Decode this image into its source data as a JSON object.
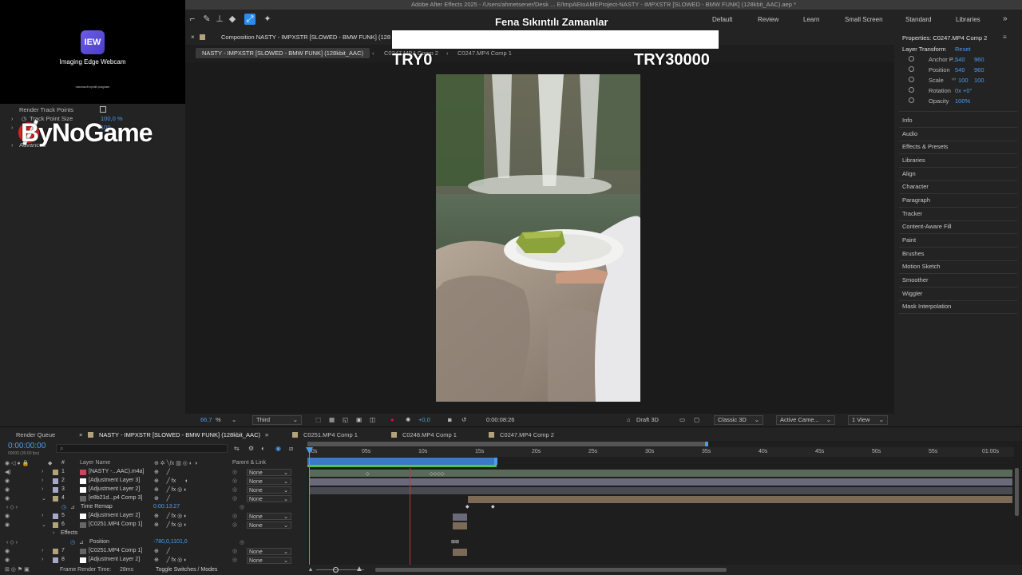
{
  "window": {
    "title": "Adobe After Effects 2025 - /Users/ahmetsener/Desk ... E/tmpAEtoAMEProject-NASTY - IMPXSTR [SLOWED - BMW FUNK] (128kbit_AAC).aep *"
  },
  "workspaces": [
    "Default",
    "Review",
    "Learn",
    "Small Screen",
    "Standard",
    "Libraries"
  ],
  "webcam": {
    "logo": "IEW",
    "title": "Imaging Edge Webcam",
    "subtitle": "microsoft ephill program"
  },
  "effect_controls": {
    "render_track_points": "Render Track Points",
    "track_point_size_label": "Track Point Size",
    "track_point_size_value": "100,0 %",
    "row3_value": "100",
    "advanced": "Advanced"
  },
  "brand": {
    "text": "ByNoGame"
  },
  "overlay": {
    "title": "Fena Sıkıntılı Zamanlar",
    "try_left": "TRY0",
    "try_right": "TRY30000"
  },
  "composition": {
    "tab_label": "Composition NASTY - IMPXSTR [SLOWED - BMW FUNK] (128",
    "sub_tabs": [
      "NASTY - IMPXSTR [SLOWED - BMW FUNK] (128kbit_AAC)",
      "C0247.MP4 Comp 2",
      "C0247.MP4 Comp 1"
    ]
  },
  "viewer_bar": {
    "zoom": "66,7",
    "zoom_unit": "%",
    "resolution": "Third",
    "exposure": "+0,0",
    "timecode": "0:00:08:26",
    "draft3d": "Draft 3D",
    "renderer": "Classic 3D",
    "camera": "Active Came...",
    "views": "1 View"
  },
  "properties": {
    "title": "Properties: C0247.MP4 Comp 2",
    "section": "Layer Transform",
    "reset": "Reset",
    "rows": [
      {
        "label": "Anchor P...",
        "v1": "540",
        "v2": "960"
      },
      {
        "label": "Position",
        "v1": "540",
        "v2": "960"
      },
      {
        "label": "Scale",
        "v1": "100",
        "v2": "100"
      },
      {
        "label": "Rotation",
        "v1": "0x +0°",
        "v2": ""
      },
      {
        "label": "Opacity",
        "v1": "100%",
        "v2": ""
      }
    ],
    "panels": [
      "Info",
      "Audio",
      "Effects & Presets",
      "Libraries",
      "Align",
      "Character",
      "Paragraph",
      "Tracker",
      "Content-Aware Fill",
      "Paint",
      "Brushes",
      "Motion Sketch",
      "Smoother",
      "Wiggler",
      "Mask Interpolation"
    ]
  },
  "timeline": {
    "tabs": [
      "Render Queue",
      "NASTY - IMPXSTR [SLOWED - BMW FUNK] (128kbit_AAC)",
      "C0251.MP4 Comp 1",
      "C0248.MP4 Comp 1",
      "C0247.MP4 Comp 2"
    ],
    "current_time": "0:00:00:00",
    "current_time_sub": "00000 (30.00 fps)",
    "header": {
      "num": "#",
      "layer_name": "Layer Name",
      "parent": "Parent & Link"
    },
    "ruler": [
      "00s",
      "05s",
      "10s",
      "15s",
      "20s",
      "25s",
      "30s",
      "35s",
      "40s",
      "45s",
      "50s",
      "55s",
      "01:00s"
    ],
    "layers": [
      {
        "num": "1",
        "name": "[NASTY -...AAC).m4a]",
        "parent": "None"
      },
      {
        "num": "2",
        "name": "[Adjustment Layer 3]",
        "parent": "None"
      },
      {
        "num": "3",
        "name": "[Adjustment Layer 2]",
        "parent": "None"
      },
      {
        "num": "4",
        "name": "[e8b21d...p4 Comp 3]",
        "parent": "None"
      },
      {
        "num": "5",
        "name": "[Adjustment Layer 2]",
        "parent": "None"
      },
      {
        "num": "6",
        "name": "[C0251.MP4 Comp 1]",
        "parent": "None"
      },
      {
        "num": "7",
        "name": "[C0251.MP4 Comp 1]",
        "parent": "None"
      },
      {
        "num": "8",
        "name": "[Adjustment Layer 2]",
        "parent": "None"
      }
    ],
    "time_remap_label": "Time Remap",
    "time_remap_value": "0:00:13:27",
    "effects_label": "Effects",
    "position_label": "Position",
    "position_value": "-780,0,1101,0",
    "footer_render_label": "Frame Render Time:",
    "footer_render_value": "28ms",
    "footer_toggle": "Toggle Switches / Modes"
  },
  "colors": {
    "accent": "#2d8ceb",
    "panel": "#232323",
    "label_tan": "#b3a37a"
  }
}
